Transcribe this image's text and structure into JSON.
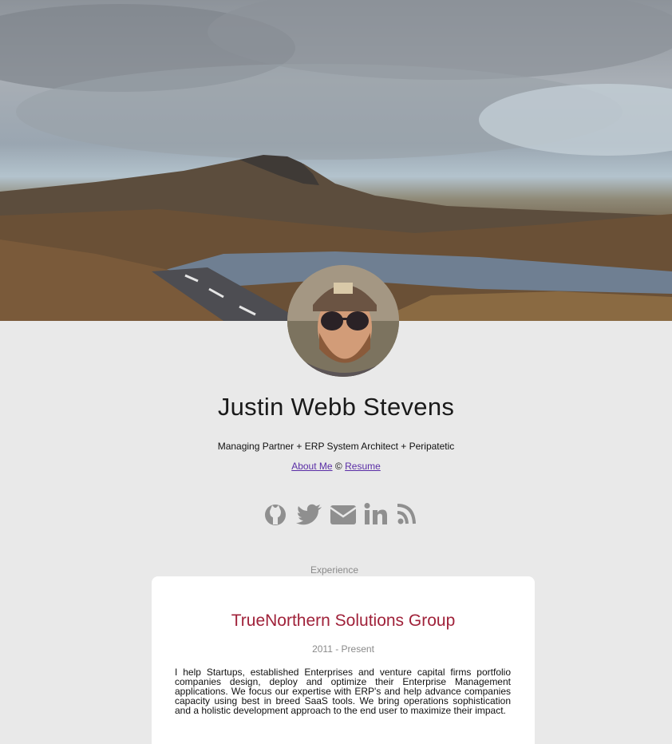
{
  "profile": {
    "name": "Justin Webb Stevens",
    "tagline": "Managing Partner + ERP System Architect + Peripatetic",
    "about_label": "About Me",
    "separator": "©",
    "resume_label": "Resume"
  },
  "social": {
    "icons": [
      "github-icon",
      "twitter-icon",
      "envelope-icon",
      "linkedin-icon",
      "rss-icon"
    ],
    "icon_color": "#8f8f8f"
  },
  "experience": {
    "section_label": "Experience",
    "company": "TrueNorthern Solutions Group",
    "period": "2011 - Present",
    "description": "I help Startups, established Enterprises and venture capital firms portfolio companies design, deploy and optimize their Enterprise Management applications. We focus our expertise with ERP's and help advance companies capacity using best in breed SaaS tools. We bring operations sophistication and a holistic development approach to the end user to maximize their impact."
  },
  "colors": {
    "background": "#e9e9e9",
    "company_accent": "#a0223a",
    "link": "#5a2ea6"
  }
}
